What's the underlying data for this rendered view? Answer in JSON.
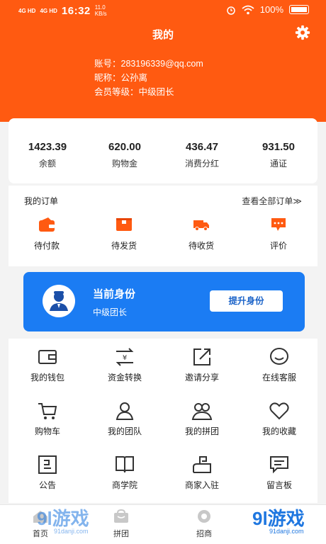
{
  "status_bar": {
    "signal1": "4G HD",
    "signal2": "4G HD",
    "time": "16:32",
    "speed": "11.0 KB/s",
    "battery": "100%"
  },
  "header": {
    "title": "我的"
  },
  "profile": {
    "account": "账号：283196339@qq.com",
    "nickname": "昵称：公孙离",
    "member_level": "会员等级：中级团长"
  },
  "stats": [
    {
      "value": "1423.39",
      "label": "余额"
    },
    {
      "value": "620.00",
      "label": "购物金"
    },
    {
      "value": "436.47",
      "label": "消费分红"
    },
    {
      "value": "931.50",
      "label": "通证"
    }
  ],
  "orders": {
    "title": "我的订单",
    "view_all": "查看全部订单≫",
    "items": [
      {
        "label": "待付款",
        "icon": "wallet-icon"
      },
      {
        "label": "待发货",
        "icon": "package-icon"
      },
      {
        "label": "待收货",
        "icon": "truck-icon"
      },
      {
        "label": "评价",
        "icon": "comment-icon"
      }
    ]
  },
  "identity": {
    "title": "当前身份",
    "level": "中级团长",
    "upgrade_label": "提升身份"
  },
  "services": [
    {
      "label": "我的钱包",
      "icon": "wallet-outline-icon"
    },
    {
      "label": "资金转换",
      "icon": "exchange-icon"
    },
    {
      "label": "邀请分享",
      "icon": "share-icon"
    },
    {
      "label": "在线客服",
      "icon": "chat-smile-icon"
    },
    {
      "label": "购物车",
      "icon": "cart-icon"
    },
    {
      "label": "我的团队",
      "icon": "team-icon"
    },
    {
      "label": "我的拼团",
      "icon": "group-icon"
    },
    {
      "label": "我的收藏",
      "icon": "heart-icon"
    },
    {
      "label": "公告",
      "icon": "notice-icon"
    },
    {
      "label": "商学院",
      "icon": "book-icon"
    },
    {
      "label": "商家入驻",
      "icon": "merchant-icon"
    },
    {
      "label": "留言板",
      "icon": "message-icon"
    }
  ],
  "tabbar": [
    {
      "label": "首页",
      "icon": "home-icon"
    },
    {
      "label": "拼团",
      "icon": "group-buy-icon"
    },
    {
      "label": "招商",
      "icon": "invest-icon"
    }
  ],
  "watermark": {
    "text": "9l游戏",
    "sub": "91danji.com"
  },
  "colors": {
    "brand": "#ff5a11",
    "identity_card": "#1b7cf3"
  }
}
